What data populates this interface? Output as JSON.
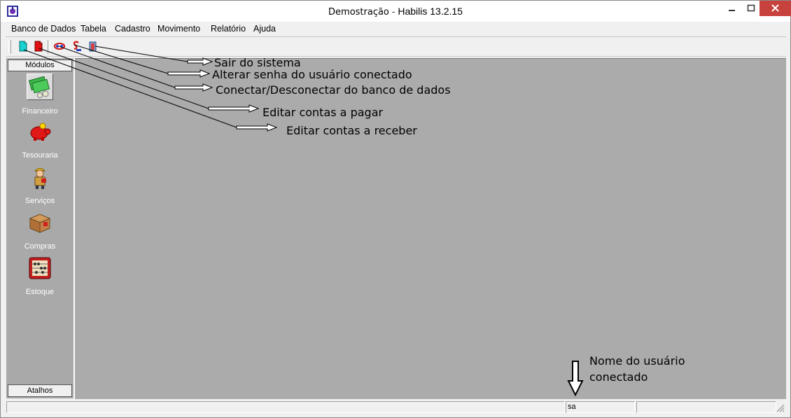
{
  "window": {
    "title_doc": "Demostração",
    "title_sep": "-",
    "title_app": "Habilis 13.2.15",
    "close_color": "#c7423d"
  },
  "menu": [
    {
      "label": "Banco de Dados"
    },
    {
      "label": "Tabela"
    },
    {
      "label": "Cadastro"
    },
    {
      "label": "Movimento"
    },
    {
      "label": "Relatório"
    },
    {
      "label": "Ajuda"
    }
  ],
  "toolbar": {
    "icons": [
      "contas-receber-icon",
      "contas-pagar-icon",
      "database-connect-icon",
      "password-icon",
      "exit-icon"
    ]
  },
  "sidebar": {
    "header": "Módulos",
    "footer": "Atalhos",
    "modules": [
      {
        "label": "Financeiro",
        "icon": "money-icon"
      },
      {
        "label": "Tesouraria",
        "icon": "piggy-bank-icon"
      },
      {
        "label": "Serviços",
        "icon": "worker-icon"
      },
      {
        "label": "Compras",
        "icon": "box-icon"
      },
      {
        "label": "Estoque",
        "icon": "abacus-icon"
      }
    ]
  },
  "annotations": {
    "exit": "Sair do sistema",
    "password": "Alterar senha do usuário conectado",
    "connect": "Conectar/Desconectar do banco de dados",
    "pagar": "Editar contas a pagar",
    "receber": "Editar contas a receber",
    "user_line1": "Nome do usuário",
    "user_line2": "conectado"
  },
  "status": {
    "user": "sa"
  }
}
